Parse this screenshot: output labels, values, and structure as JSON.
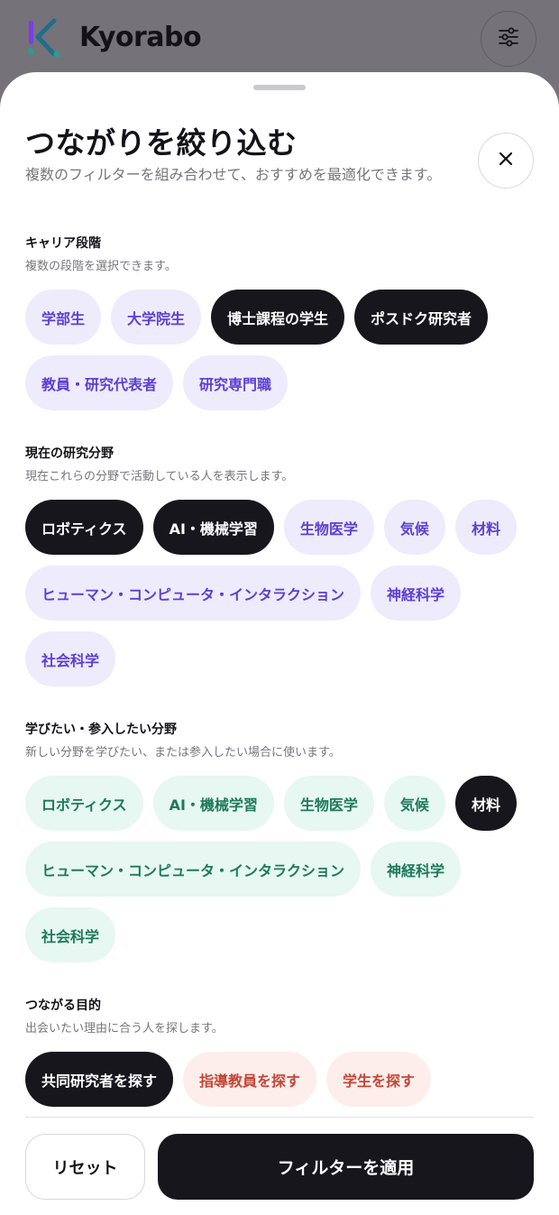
{
  "app": {
    "name": "Kyorabo",
    "logo_icon": "kyorabo-logo-icon",
    "filter_icon": "sliders-icon"
  },
  "sheet": {
    "title": "つながりを絞り込む",
    "subtitle": "複数のフィルターを組み合わせて、おすすめを最適化できます。",
    "close_icon": "close-icon"
  },
  "sections": [
    {
      "title": "キャリア段階",
      "description": "複数の段階を選択できます。",
      "theme": "purple",
      "chips": [
        {
          "label": "学部生",
          "selected": false
        },
        {
          "label": "大学院生",
          "selected": false
        },
        {
          "label": "博士課程の学生",
          "selected": true
        },
        {
          "label": "ポスドク研究者",
          "selected": true
        },
        {
          "label": "教員・研究代表者",
          "selected": false
        },
        {
          "label": "研究専門職",
          "selected": false
        }
      ]
    },
    {
      "title": "現在の研究分野",
      "description": "現在これらの分野で活動している人を表示します。",
      "theme": "purple",
      "chips": [
        {
          "label": "ロボティクス",
          "selected": true
        },
        {
          "label": "AI・機械学習",
          "selected": true
        },
        {
          "label": "生物医学",
          "selected": false
        },
        {
          "label": "気候",
          "selected": false
        },
        {
          "label": "材料",
          "selected": false
        },
        {
          "label": "ヒューマン・コンピュータ・インタラクション",
          "selected": false
        },
        {
          "label": "神経科学",
          "selected": false
        },
        {
          "label": "社会科学",
          "selected": false
        }
      ]
    },
    {
      "title": "学びたい・参入したい分野",
      "description": "新しい分野を学びたい、または参入したい場合に使います。",
      "theme": "green",
      "chips": [
        {
          "label": "ロボティクス",
          "selected": false
        },
        {
          "label": "AI・機械学習",
          "selected": false
        },
        {
          "label": "生物医学",
          "selected": false
        },
        {
          "label": "気候",
          "selected": false
        },
        {
          "label": "材料",
          "selected": true
        },
        {
          "label": "ヒューマン・コンピュータ・インタラクション",
          "selected": false
        },
        {
          "label": "神経科学",
          "selected": false
        },
        {
          "label": "社会科学",
          "selected": false
        }
      ]
    },
    {
      "title": "つながる目的",
      "description": "出会いたい理由に合う人を探します。",
      "theme": "red",
      "chips": [
        {
          "label": "共同研究者を探す",
          "selected": true
        },
        {
          "label": "指導教員を探す",
          "selected": false
        },
        {
          "label": "学生を探す",
          "selected": false
        }
      ]
    }
  ],
  "footer": {
    "reset_label": "リセット",
    "apply_label": "フィルターを適用"
  },
  "colors": {
    "accent_dark": "#17161d",
    "chip_purple_bg": "#eeebfd",
    "chip_purple_text": "#5d3fd3",
    "chip_green_bg": "#e7f7f1",
    "chip_green_text": "#1d7a5c",
    "chip_red_bg": "#fdeeec",
    "chip_red_text": "#c54535"
  }
}
